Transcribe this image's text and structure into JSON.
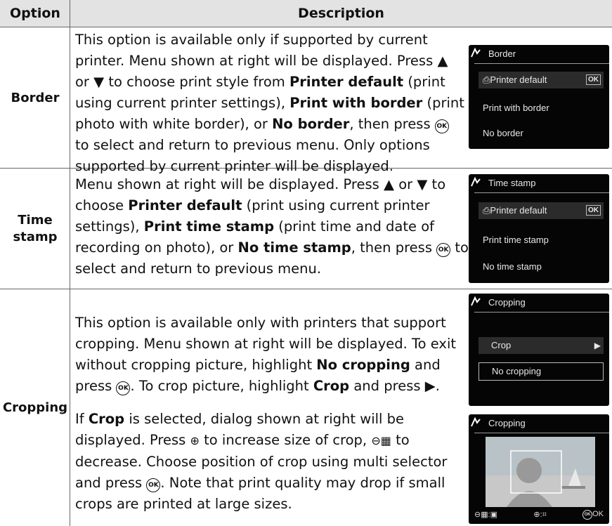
{
  "header": {
    "option": "Option",
    "description": "Description"
  },
  "rows": [
    {
      "option": "Border",
      "screen": {
        "title": "Border",
        "items": [
          "Printer default",
          "Print with border",
          "No border"
        ],
        "selected_badge": "OK"
      }
    },
    {
      "option_line1": "Time",
      "option_line2": "stamp",
      "screen": {
        "title": "Time stamp",
        "items": [
          "Printer default",
          "Print time stamp",
          "No time stamp"
        ],
        "selected_badge": "OK"
      }
    },
    {
      "option": "Cropping",
      "screen1": {
        "title": "Cropping",
        "items": [
          "Crop",
          "No cropping"
        ]
      },
      "screen2": {
        "title": "Cropping",
        "footer": {
          "zoom_out": "⊖▦:▣",
          "zoom_in": "⊕:⌗",
          "ok": "OK"
        }
      }
    }
  ],
  "ok_symbol": "OK",
  "text": {
    "b1": "This option is available only if supported by current",
    "b2": "printer.  Menu shown at right will be displayed.  Press ▲",
    "b3a": "or ▼ to choose print style from ",
    "b3b": "Printer default",
    "b3c": " (print",
    "b4a": "using current printer settings), ",
    "b4b": "Print with border",
    "b4c": " (print",
    "b5a": "photo with white border), or ",
    "b5b": "No border",
    "b5c": ", then press ",
    "b6": "to select and return to previous menu.  Only options",
    "b7": "supported by current printer will be displayed.",
    "t1": "Menu shown at right will be displayed.  Press ▲ or ▼ to",
    "t2a": "choose ",
    "t2b": "Printer default",
    "t2c": " (print using current printer",
    "t3a": "settings), ",
    "t3b": "Print time stamp",
    "t3c": " (print time and date of",
    "t4a": "recording on photo), or ",
    "t4b": "No time stamp",
    "t4c": ", then press ",
    "t4d": " to",
    "t5": "select and return to previous menu.",
    "c1": "This option is available only with printers that support",
    "c2": "cropping.  Menu shown at right will be displayed.  To exit",
    "c3a": "without cropping picture, highlight ",
    "c3b": "No cropping",
    "c3c": " and",
    "c4a": "press ",
    "c4b": ".  To crop picture, highlight ",
    "c4c": "Crop",
    "c4d": " and press ▶.",
    "c5a": "If ",
    "c5b": "Crop",
    "c5c": " is selected, dialog shown at right will be",
    "c6a": "displayed.  Press ",
    "c6b": "⊕",
    "c6c": " to increase size of crop, ",
    "c6d": "⊖▦",
    "c6e": " to",
    "c7": "decrease.  Choose position of crop using multi selector",
    "c8a": "and press ",
    "c8b": ".  Note that print quality may drop if small",
    "c9": "crops are printed at large sizes."
  }
}
